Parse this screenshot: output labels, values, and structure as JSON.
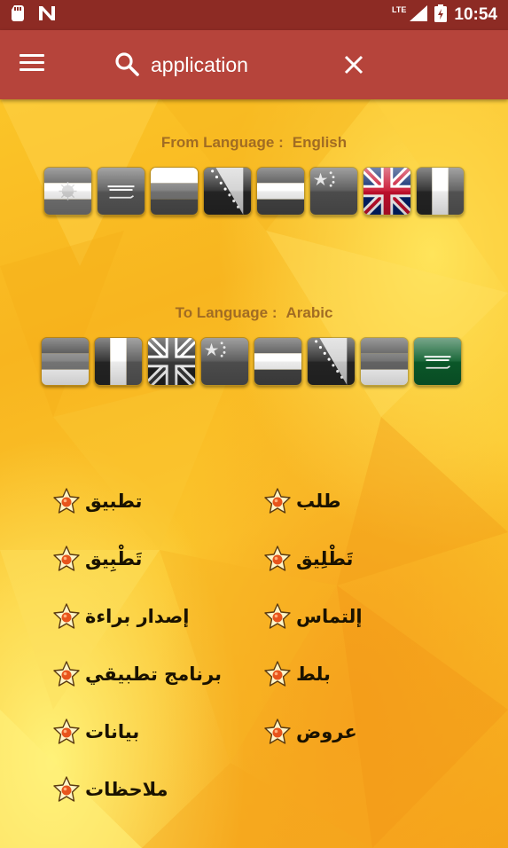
{
  "status_bar": {
    "network": "LTE",
    "time": "10:54"
  },
  "toolbar": {
    "search_value": "application"
  },
  "from_language": {
    "label": "From Language :",
    "value": "English",
    "flags": [
      "kurdistan-flag",
      "saudi-flag",
      "bulgaria-flag",
      "bosnia-flag",
      "netherlands-flag",
      "china-flag",
      "uk-flag",
      "france-flag"
    ],
    "selected": "uk-flag"
  },
  "to_language": {
    "label": "To Language :",
    "value": "Arabic",
    "flags": [
      "bulgaria-flag",
      "france-flag",
      "uk-flag",
      "china-flag",
      "netherlands-flag",
      "bosnia-flag",
      "bulgaria-flag",
      "saudi-flag"
    ],
    "selected": "saudi-flag"
  },
  "translations": {
    "left": [
      "تطبيق",
      "تَطْبِيق",
      "إصدار براءة",
      "برنامج تطبيقي",
      "بيانات",
      "ملاحظات"
    ],
    "right": [
      "طلب",
      "تَطْلِيق",
      "إلتماس",
      "بلط",
      "عروض"
    ]
  },
  "colors": {
    "status_bar": "#8d2b24",
    "toolbar": "#b6443b",
    "label_text": "#a16c23"
  }
}
